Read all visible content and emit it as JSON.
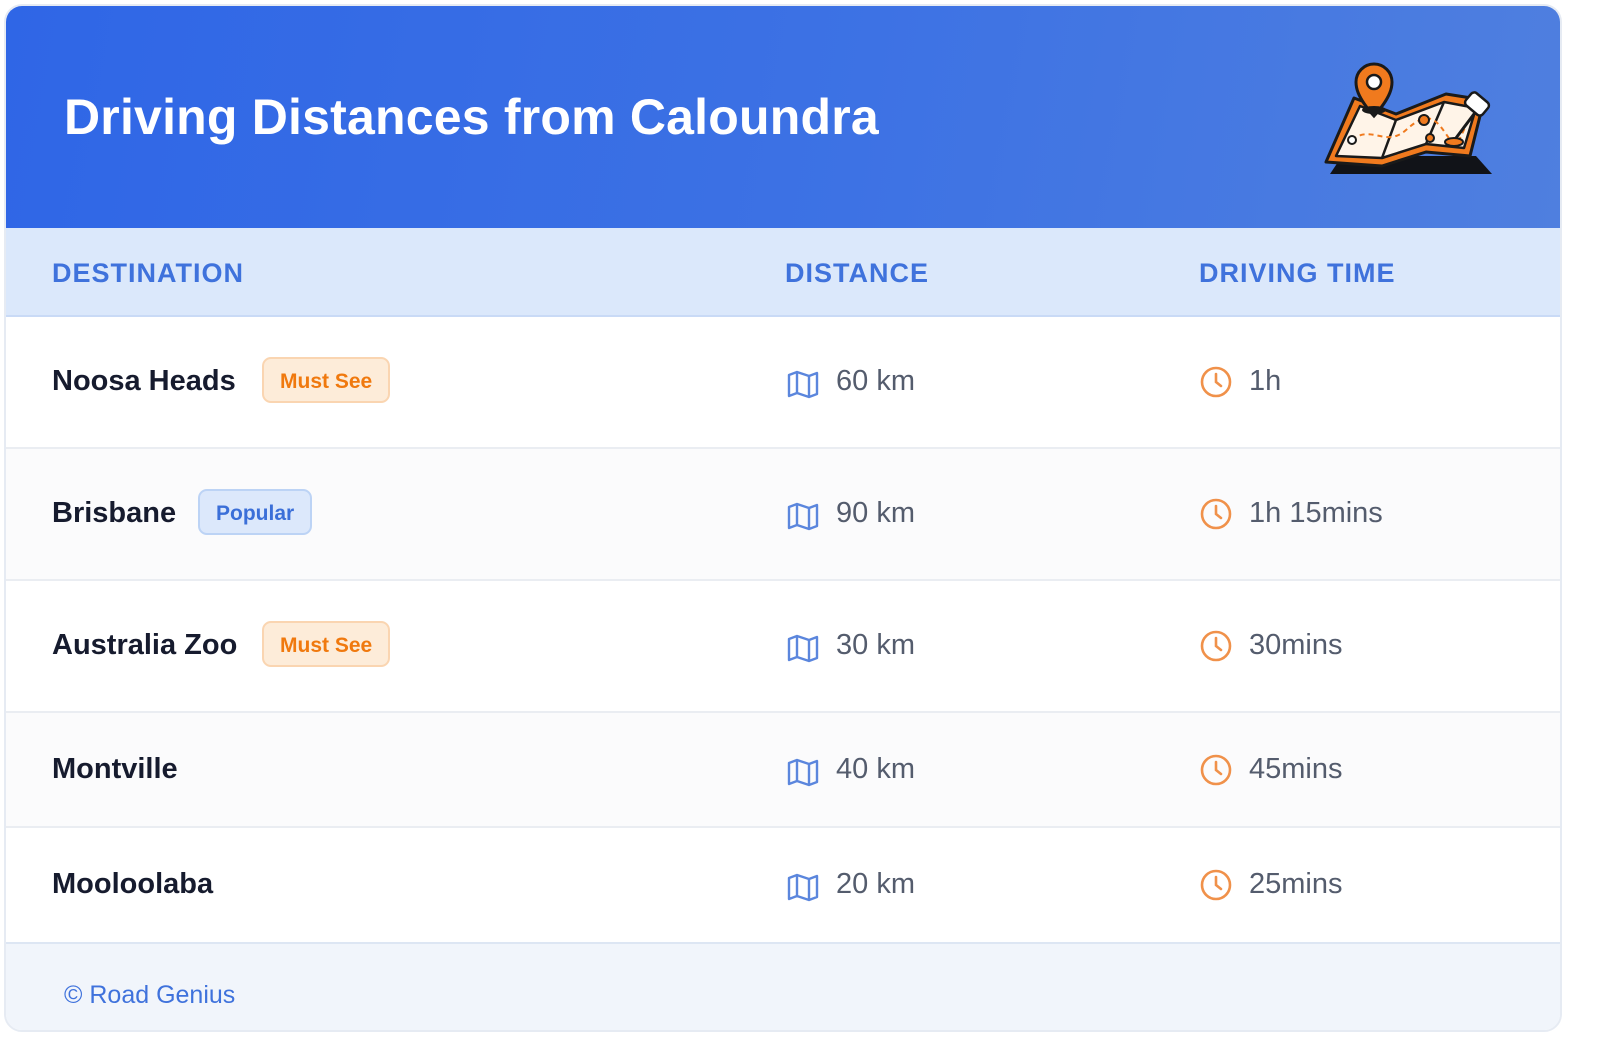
{
  "header": {
    "title": "Driving Distances from Caloundra",
    "illustration_icon": "map-with-pins-icon"
  },
  "columns": {
    "destination": "DESTINATION",
    "distance": "DISTANCE",
    "driving_time": "DRIVING TIME"
  },
  "rows": [
    {
      "destination": "Noosa Heads",
      "badge": "Must See",
      "badge_color": "#f0790e",
      "distance": "60 km",
      "time": "1h"
    },
    {
      "destination": "Brisbane",
      "badge": "Popular",
      "badge_color": "#3b6fd8",
      "distance": "90 km",
      "time": "1h 15mins"
    },
    {
      "destination": "Australia Zoo",
      "badge": "Must See",
      "badge_color": "#f0790e",
      "distance": "30 km",
      "time": "30mins"
    },
    {
      "destination": "Montville",
      "distance": "40 km",
      "time": "45mins"
    },
    {
      "destination": "Mooloolaba",
      "distance": "20 km",
      "time": "25mins"
    }
  ],
  "icons": {
    "distance": "map-icon",
    "time": "clock-icon"
  },
  "footer": {
    "copyright": "© Road Genius"
  },
  "colors": {
    "header_blue": "#2f66e6",
    "accent_blue": "#3f72dc",
    "accent_orange": "#f0790e"
  }
}
